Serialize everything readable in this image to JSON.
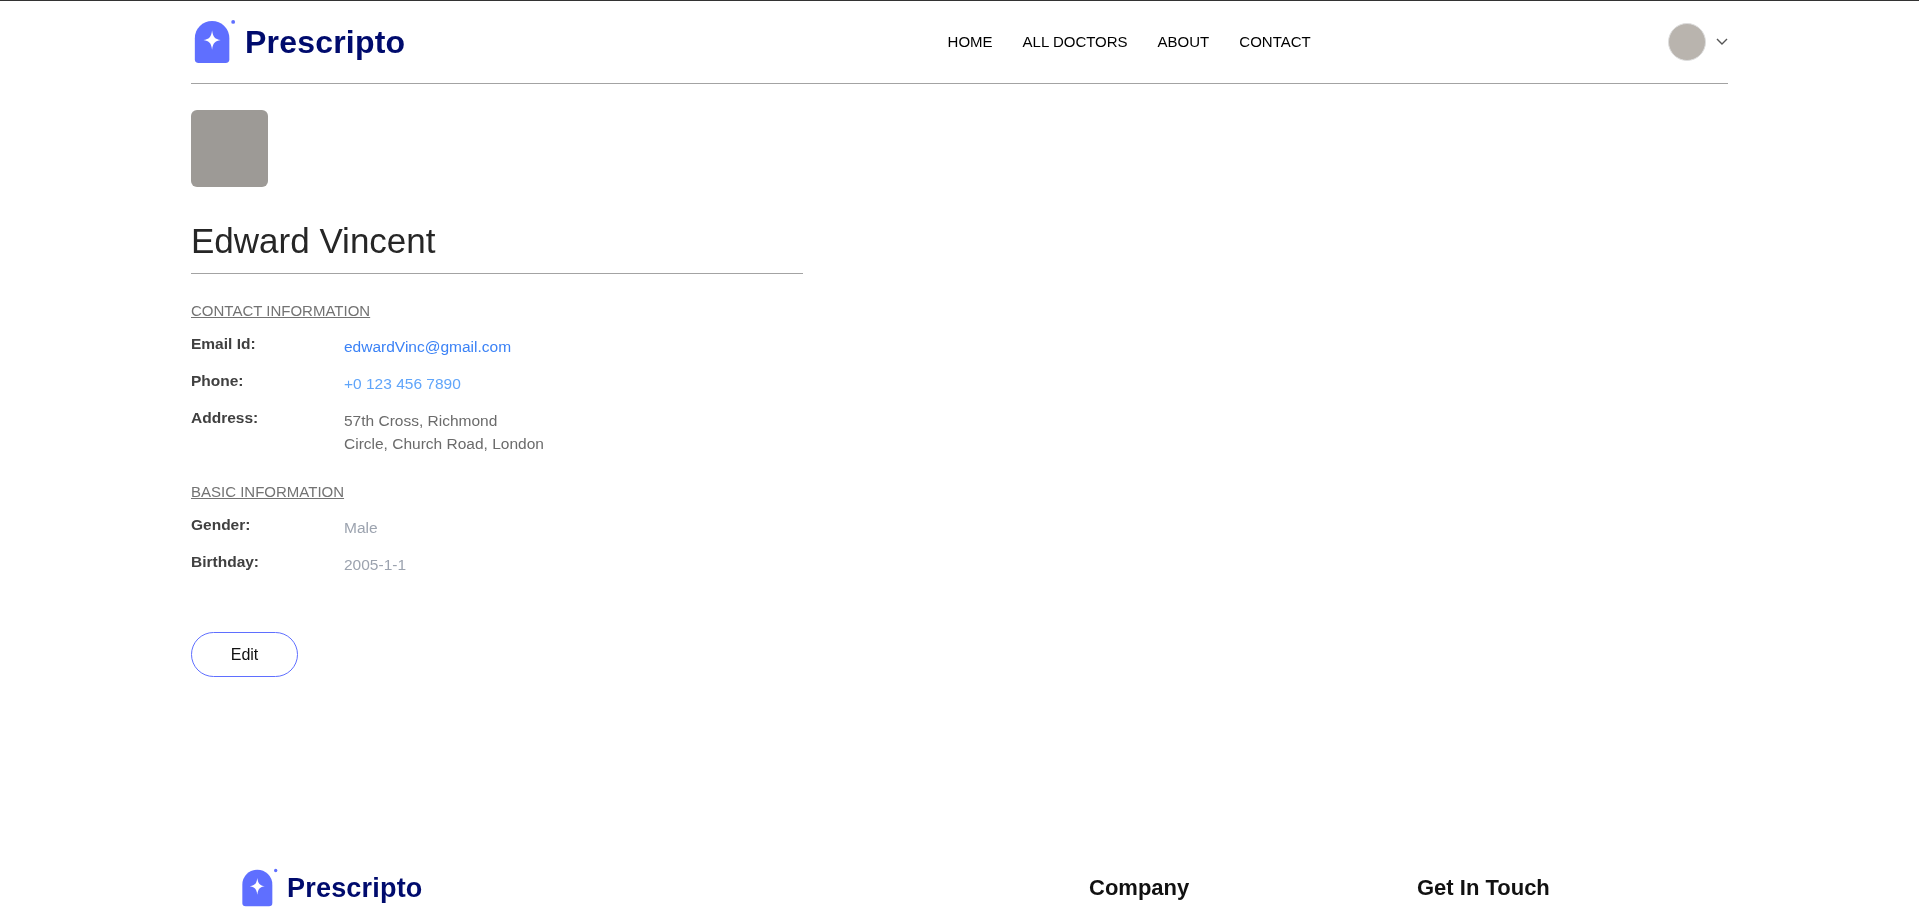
{
  "header": {
    "logo_text": "Prescripto",
    "nav": [
      {
        "label": "HOME",
        "selected": false
      },
      {
        "label": "ALL DOCTORS",
        "selected": false
      },
      {
        "label": "ABOUT",
        "selected": false
      },
      {
        "label": "CONTACT",
        "selected": false
      }
    ]
  },
  "profile": {
    "name": "Edward Vincent",
    "sections": [
      {
        "title": "CONTACT INFORMATION",
        "fields": [
          {
            "label": "Email Id:",
            "value": "edwardVinc@gmail.com",
            "kind": "email"
          },
          {
            "label": "Phone:",
            "value": "+0 123 456 7890",
            "kind": "phone"
          },
          {
            "label": "Address:",
            "value": "57th Cross, Richmond",
            "value_2": "Circle, Church Road, London",
            "kind": "address"
          }
        ]
      },
      {
        "title": "BASIC INFORMATION",
        "fields": [
          {
            "label": "Gender:",
            "value": "Male",
            "kind": "plain"
          },
          {
            "label": "Birthday:",
            "value": "2005-1-1",
            "kind": "plain"
          }
        ]
      }
    ],
    "edit_button": "Edit"
  },
  "footer": {
    "logo_text": "Prescripto",
    "columns": [
      "Company",
      "Get In Touch"
    ]
  }
}
